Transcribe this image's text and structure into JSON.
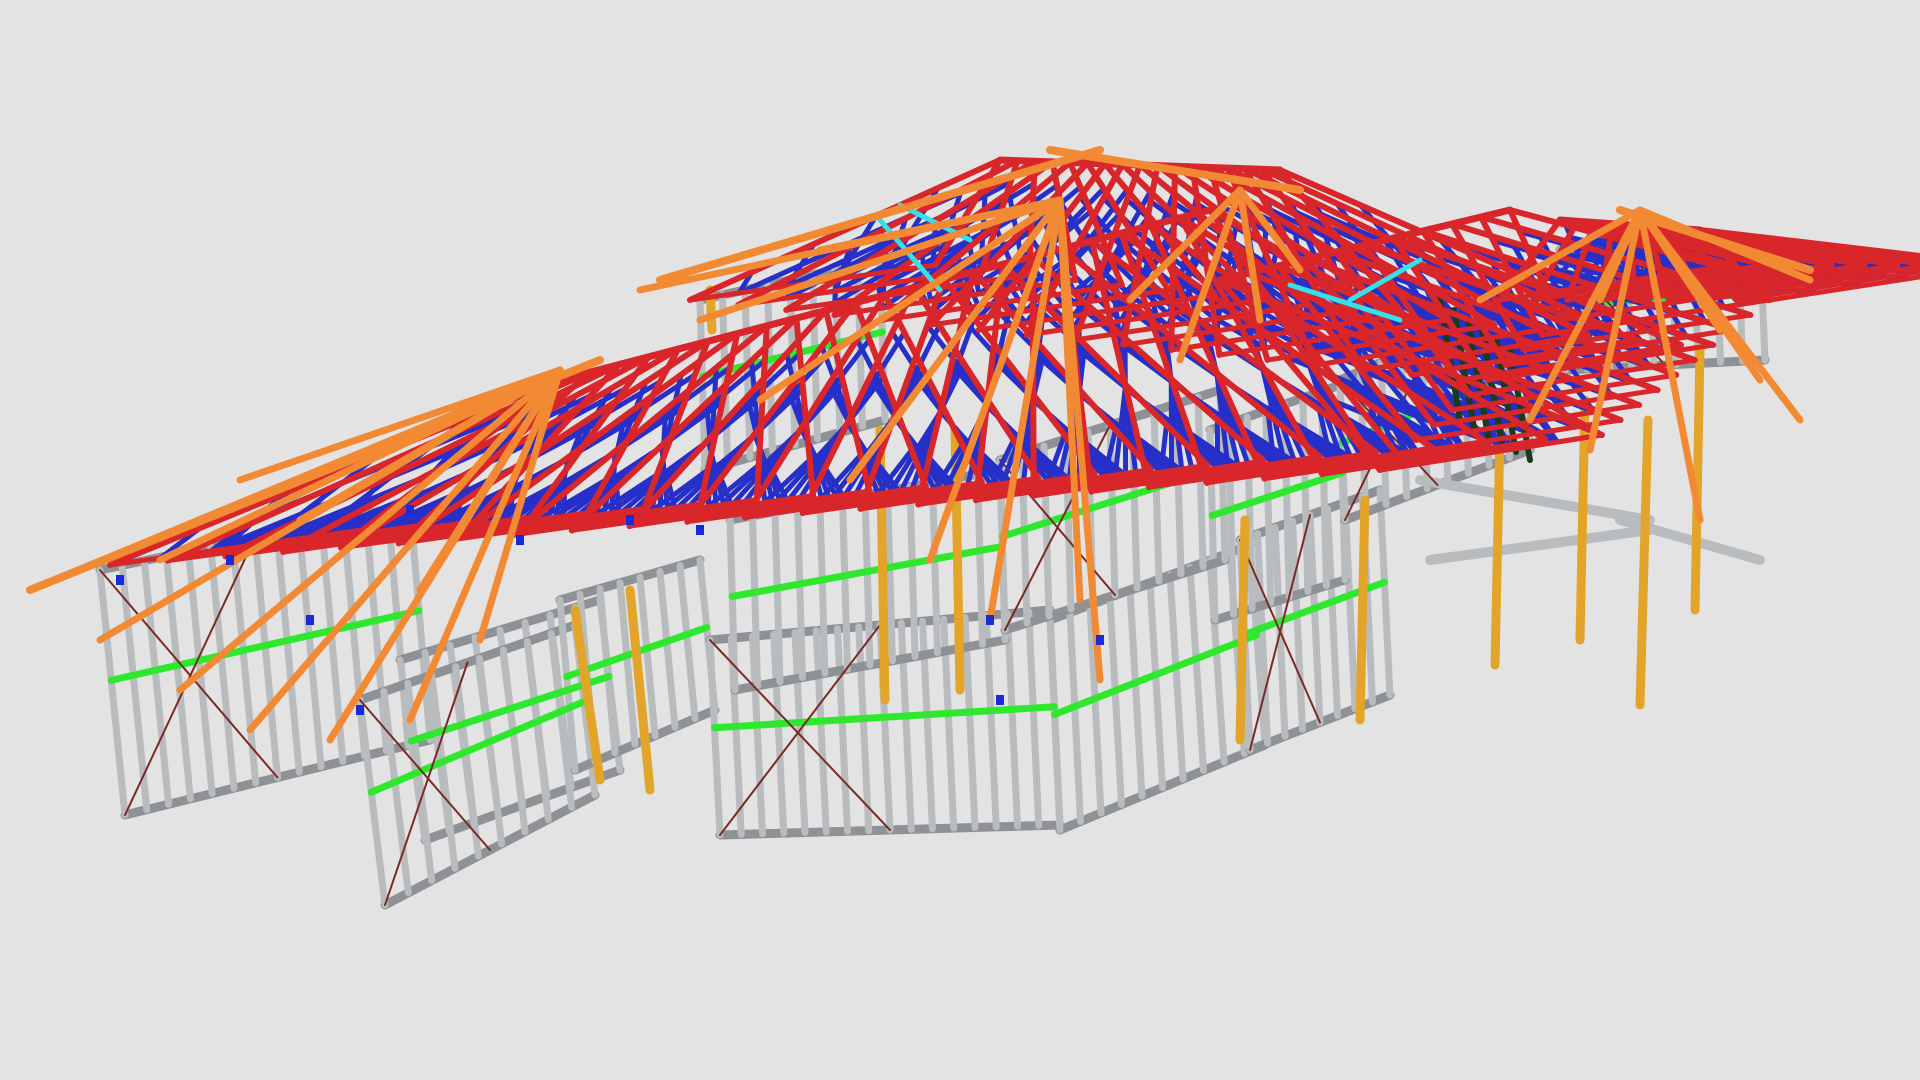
{
  "scene": {
    "subject": "steel-frame-house-model",
    "colors": {
      "background": "#e3e3e3",
      "wall_studs": "#b9bcbf",
      "wall_stud_edge": "#8e9296",
      "nogging": "#2ee82e",
      "bracing": "#7a2a24",
      "jamb_post": "#e2a52a",
      "truss_chord": "#d8262a",
      "truss_web": "#2630c8",
      "hip_rafter": "#f28a34",
      "girder_truss": "#35e0e6",
      "dark_web": "#1c3a1c",
      "connector": "#1a2ad8"
    }
  }
}
